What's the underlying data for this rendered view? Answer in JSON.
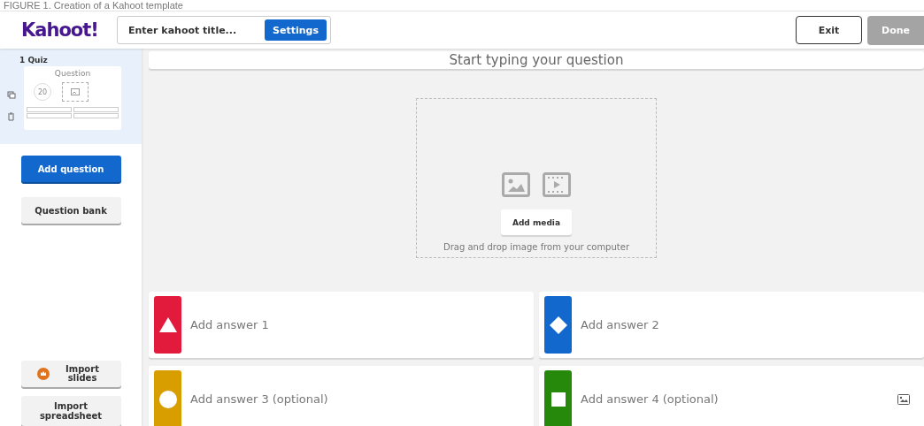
{
  "caption": "FIGURE 1. Creation of a Kahoot template",
  "top_bar": {
    "logo": "Kahoot!",
    "title_field": {
      "placeholder": "Enter kahoot title..."
    },
    "settings_button": "Settings",
    "exit_button": "Exit",
    "done_button": {
      "label": "Done",
      "disabled": true
    }
  },
  "sidebar": {
    "questions": [
      {
        "label": "1 Quiz",
        "preview_title": "Question",
        "timer": "20",
        "selected": true
      }
    ],
    "add_question_button": "Add question",
    "question_bank_button": "Question bank",
    "import_slides_button": "Import slides",
    "import_spreadsheet_button": "Import spreadsheet"
  },
  "editor": {
    "question_field": {
      "placeholder": "Start typing your question"
    },
    "add_media_button": "Add media",
    "drop_hint": "Drag and drop image from your computer",
    "answers": [
      {
        "placeholder": "Add answer 1",
        "kind": "triangle",
        "color": "#e21b3c",
        "media_icon": false
      },
      {
        "placeholder": "Add answer 2",
        "kind": "diamond",
        "color": "#1368ce",
        "media_icon": false
      },
      {
        "placeholder": "Add answer 3 (optional)",
        "kind": "circle",
        "color": "#d89e00",
        "media_icon": false
      },
      {
        "placeholder": "Add answer 4 (optional)",
        "kind": "square",
        "color": "#26890c",
        "media_icon": true
      }
    ]
  }
}
